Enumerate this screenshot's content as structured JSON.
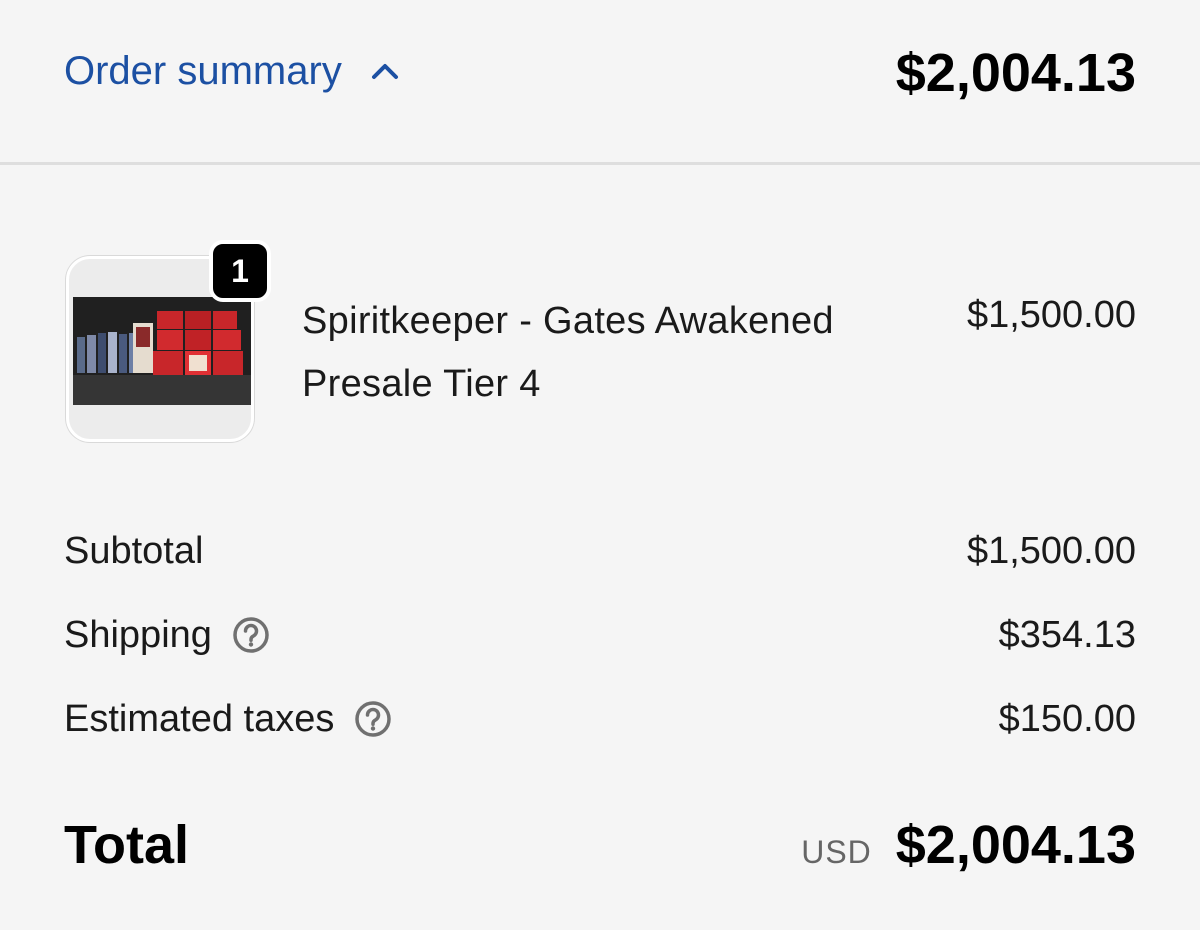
{
  "header": {
    "toggle_label": "Order summary",
    "toggle_icon": "chevron-up-icon",
    "total": "$2,004.13"
  },
  "item": {
    "quantity": "1",
    "name": "Spiritkeeper - Gates Awakened Presale Tier 4",
    "price": "$1,500.00"
  },
  "summary": {
    "subtotal_label": "Subtotal",
    "subtotal_value": "$1,500.00",
    "shipping_label": "Shipping",
    "shipping_value": "$354.13",
    "taxes_label": "Estimated taxes",
    "taxes_value": "$150.00",
    "total_label": "Total",
    "currency": "USD",
    "total_value": "$2,004.13"
  },
  "colors": {
    "link": "#1c50a3",
    "background": "#f5f5f5",
    "divider": "#dedede",
    "icon_gray": "#707070"
  }
}
